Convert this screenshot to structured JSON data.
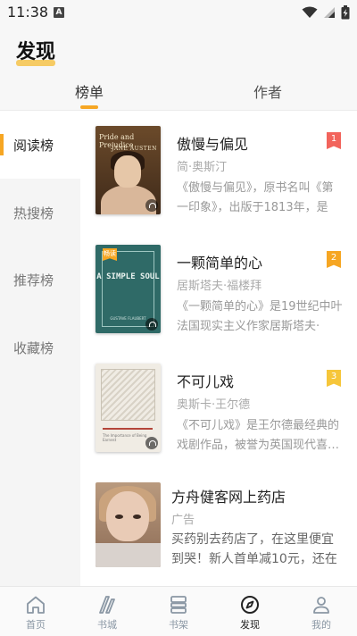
{
  "status_bar": {
    "time": "11:38",
    "notification_letter": "A"
  },
  "header": {
    "title": "发现"
  },
  "tabs": [
    {
      "label": "榜单",
      "active": true
    },
    {
      "label": "作者",
      "active": false
    }
  ],
  "side_menu": [
    {
      "label": "阅读榜",
      "active": true
    },
    {
      "label": "热搜榜",
      "active": false
    },
    {
      "label": "推荐榜",
      "active": false
    },
    {
      "label": "收藏榜",
      "active": false
    }
  ],
  "books": [
    {
      "title": "傲慢与偏见",
      "author": "简·奥斯汀",
      "description": "《傲慢与偏见》，原书名叫《第一印象》，出版于1813年，是1…",
      "rank": "1",
      "rank_color": "#f2645c",
      "cover_title": "Pride and Prejudice",
      "cover_author": "JANE AUSTEN"
    },
    {
      "title": "一颗简单的心",
      "author": "居斯塔夫·福楼拜",
      "description": "《一颗简单的心》是19世纪中叶法国现实主义作家居斯塔夫·福…",
      "rank": "2",
      "rank_color": "#f6a623",
      "cover_tag": "畅读",
      "cover_title": "A SIMPLE SOUL",
      "cover_author": "GUSTAVE FLAUBERT"
    },
    {
      "title": "不可儿戏",
      "author": "奥斯卡·王尔德",
      "description": "《不可儿戏》是王尔德最经典的戏剧作品，被誉为英国现代喜…",
      "rank": "3",
      "rank_color": "#f6c63a",
      "cover_caption": "The Importance of Being Earnest"
    }
  ],
  "ad": {
    "title": "方舟健客网上药店",
    "label": "广告",
    "description": "买药别去药店了，在这里便宜到哭！新人首单减10元，还在等…"
  },
  "bottom_nav": [
    {
      "label": "首页",
      "icon": "home-icon",
      "active": false
    },
    {
      "label": "书城",
      "icon": "bookstore-icon",
      "active": false
    },
    {
      "label": "书架",
      "icon": "bookshelf-icon",
      "active": false
    },
    {
      "label": "发现",
      "icon": "compass-icon",
      "active": true
    },
    {
      "label": "我的",
      "icon": "profile-icon",
      "active": false
    }
  ],
  "colors": {
    "accent": "#f6a623",
    "title_highlight": "#f6c34a",
    "nav_inactive": "#8a97a4"
  }
}
